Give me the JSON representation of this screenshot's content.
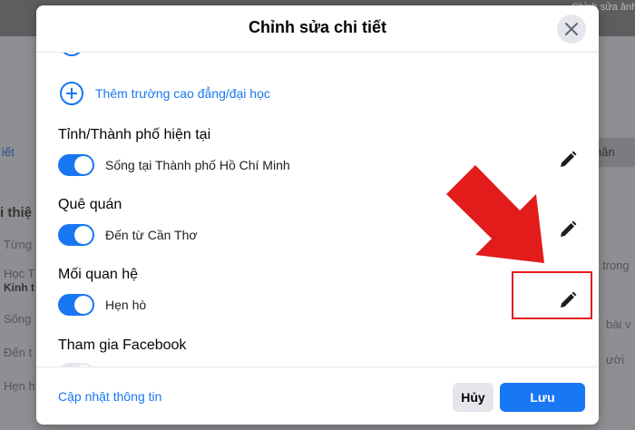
{
  "modal": {
    "title": "Chỉnh sửa chi tiết",
    "add_school_label": "Thêm trường cao đẳng/đại học"
  },
  "sections": [
    {
      "title": "Tỉnh/Thành phố hiện tại",
      "value": "Sống tại Thành phố Hồ Chí Minh",
      "toggle_on": true
    },
    {
      "title": "Quê quán",
      "value": "Đến từ Cần Thơ",
      "toggle_on": true
    },
    {
      "title": "Mối quan hệ",
      "value": "Hẹn hò",
      "toggle_on": true
    },
    {
      "title": "Tham gia Facebook",
      "toggle_on": false
    }
  ],
  "footer": {
    "update_link": "Cập nhật thông tin",
    "cancel_label": "Hủy",
    "save_label": "Lưu"
  },
  "background": {
    "top_right_text": "Chỉnh sửa ảnh",
    "left_texts": [
      "iết",
      "i thiệ",
      "Từng",
      "Học T",
      "Kinh t",
      "Sống",
      "Đến t",
      "Hẹn h"
    ],
    "right_texts": [
      "hân",
      "trong",
      "bài v",
      "ười"
    ]
  },
  "colors": {
    "accent": "#1877f2",
    "annotation": "#e21b1b"
  },
  "icons": [
    "close-icon",
    "add-circle-icon",
    "pencil-icon",
    "red-arrow"
  ]
}
